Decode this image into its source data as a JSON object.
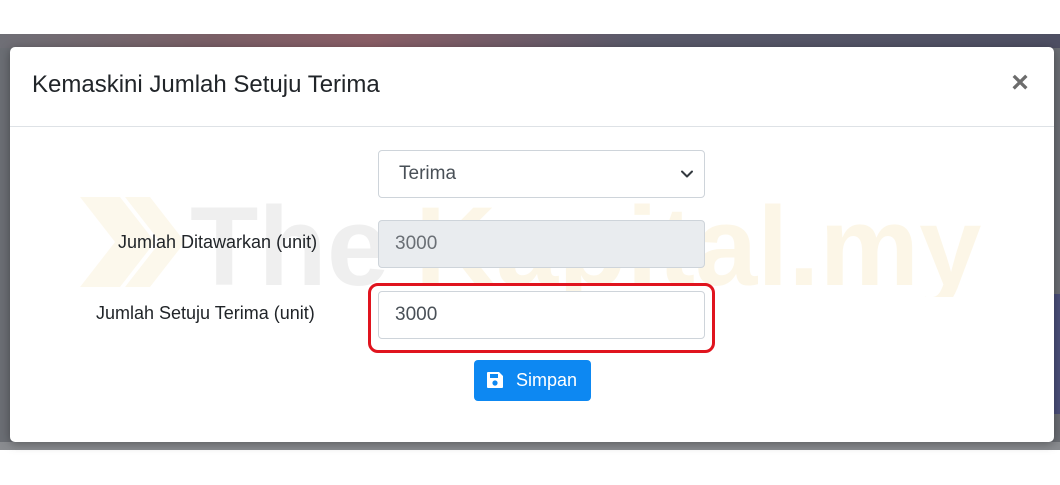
{
  "modal": {
    "title": "Kemaskini Jumlah Setuju Terima",
    "close_label": "×"
  },
  "form": {
    "status_select": {
      "selected": "Terima",
      "icon": "chevron-down-icon"
    },
    "offered": {
      "label": "Jumlah Ditawarkan (unit)",
      "value": "3000"
    },
    "accepted": {
      "label": "Jumlah Setuju Terima (unit)",
      "value": "3000"
    },
    "save_button": {
      "label": "Simpan",
      "icon": "save-icon",
      "color": "#0d88f2"
    }
  },
  "watermark": {
    "text": "TheKapital.my"
  },
  "colors": {
    "highlight": "#e0141e",
    "readonly_bg": "#e9ecef"
  }
}
